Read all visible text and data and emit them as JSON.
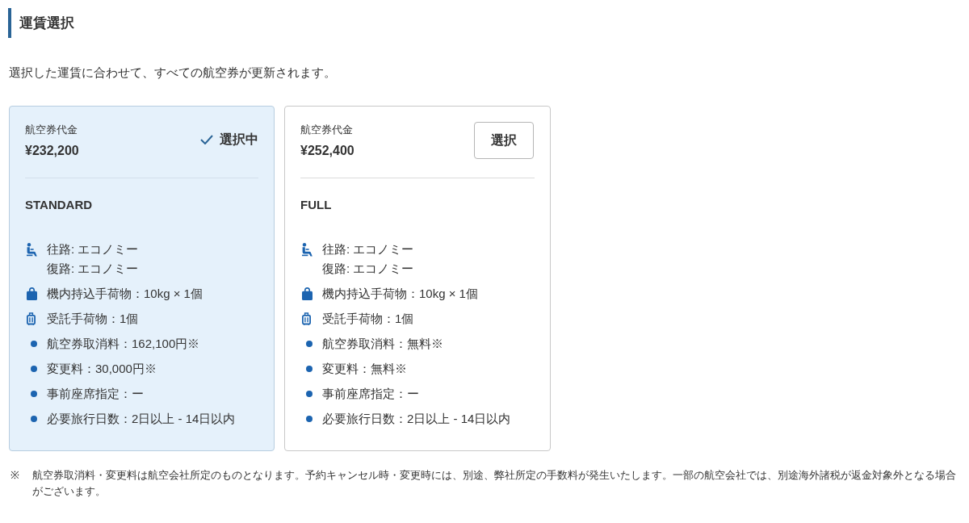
{
  "title": "運賃選択",
  "intro": "選択した運賃に合わせて、すべての航空券が更新されます。",
  "fares": [
    {
      "price_label": "航空券代金",
      "price": "¥232,200",
      "selected": true,
      "action_label": "選択中",
      "name": "STANDARD",
      "features": [
        {
          "kind": "seat",
          "lines": [
            "往路: エコノミー",
            "復路: エコノミー"
          ]
        },
        {
          "kind": "carry_on",
          "lines": [
            "機内持込手荷物：10kg × 1個"
          ]
        },
        {
          "kind": "checked_bag",
          "lines": [
            "受託手荷物：1個"
          ]
        },
        {
          "kind": "bullet",
          "lines": [
            "航空券取消料：162,100円※"
          ]
        },
        {
          "kind": "bullet",
          "lines": [
            "変更料：30,000円※"
          ]
        },
        {
          "kind": "bullet",
          "lines": [
            "事前座席指定：ー"
          ]
        },
        {
          "kind": "bullet",
          "lines": [
            "必要旅行日数：2日以上 - 14日以内"
          ]
        }
      ]
    },
    {
      "price_label": "航空券代金",
      "price": "¥252,400",
      "selected": false,
      "action_label": "選択",
      "name": "FULL",
      "features": [
        {
          "kind": "seat",
          "lines": [
            "往路: エコノミー",
            "復路: エコノミー"
          ]
        },
        {
          "kind": "carry_on",
          "lines": [
            "機内持込手荷物：10kg × 1個"
          ]
        },
        {
          "kind": "checked_bag",
          "lines": [
            "受託手荷物：1個"
          ]
        },
        {
          "kind": "bullet",
          "lines": [
            "航空券取消料：無料※"
          ]
        },
        {
          "kind": "bullet",
          "lines": [
            "変更料：無料※"
          ]
        },
        {
          "kind": "bullet",
          "lines": [
            "事前座席指定：ー"
          ]
        },
        {
          "kind": "bullet",
          "lines": [
            "必要旅行日数：2日以上 - 14日以内"
          ]
        }
      ]
    }
  ],
  "footnote": {
    "mark": "※",
    "text": "航空券取消料・変更料は航空会社所定のものとなります。予約キャンセル時・変更時には、別途、弊社所定の手数料が発生いたします。一部の航空会社では、別途海外諸税が返金対象外となる場合がございます。"
  }
}
